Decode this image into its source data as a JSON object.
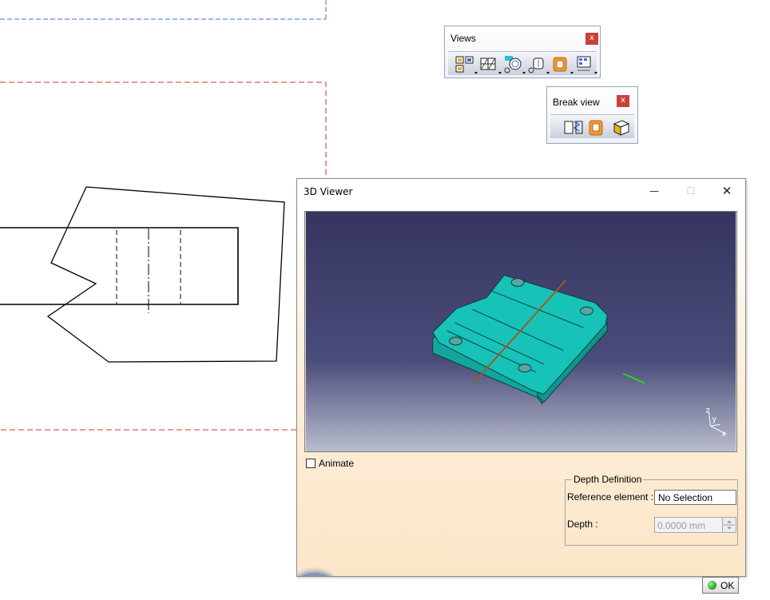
{
  "views_toolbar": {
    "title": "Views",
    "close_glyph": "x",
    "icons": [
      "front-view-icon",
      "section-view-icon",
      "detail-view-icon",
      "clipping-view-icon",
      "broken-view-icon",
      "view-wizard-icon"
    ]
  },
  "break_view_toolbar": {
    "title": "Break view",
    "close_glyph": "x",
    "icons": [
      "broken-view-icon",
      "breakout-view-icon",
      "add-3d-clipping-icon"
    ]
  },
  "viewer_dialog": {
    "title": "3D Viewer",
    "minimize_glyph": "—",
    "maximize_glyph": "☐",
    "close_glyph": "✕",
    "animate_label": "Animate",
    "animate_checked": false,
    "depth_group_title": "Depth Definition",
    "reference_label": "Reference element :",
    "reference_value": "No Selection",
    "depth_label": "Depth :",
    "depth_value": "0.0000 mm",
    "ok_label": "OK",
    "axis_labels": {
      "y": "y",
      "z": "z",
      "x": "x"
    },
    "colors": {
      "viewport_top": "#35355f",
      "viewport_bottom": "#b8bccc",
      "part_face": "#17c3b8",
      "section_line": "#a05a1e",
      "green_marker": "#23d823"
    }
  },
  "drawing": {
    "frame_blue": "#3b6fd6",
    "frame_red": "#d9302c"
  }
}
